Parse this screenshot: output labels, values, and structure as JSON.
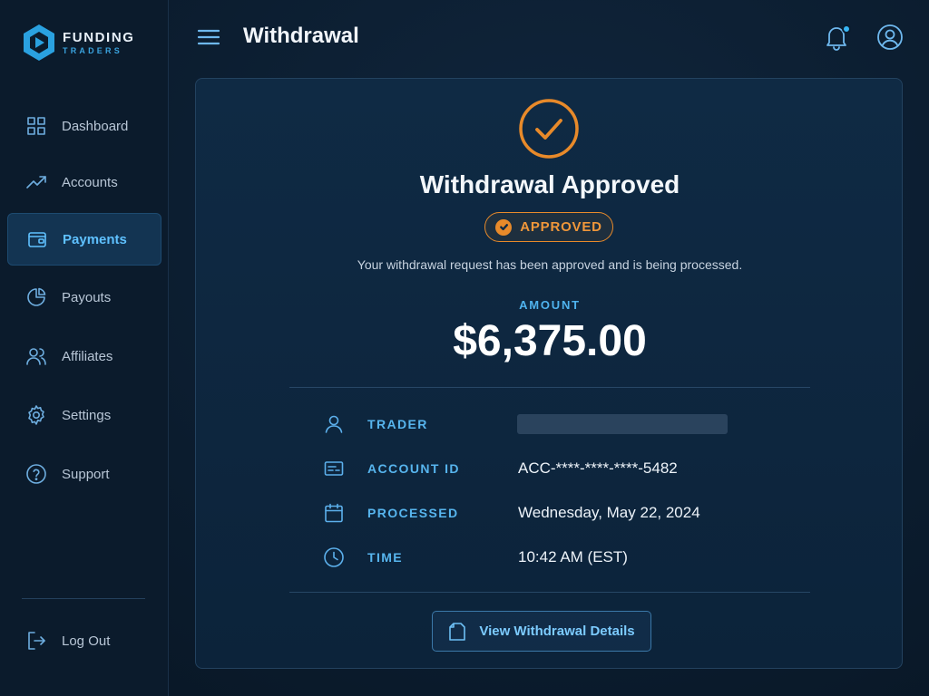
{
  "brand": {
    "title": "FUNDING",
    "subtitle": "TRADERS"
  },
  "sidebar": {
    "items": [
      {
        "label": "Dashboard",
        "icon": "grid-icon",
        "active": false
      },
      {
        "label": "Accounts",
        "icon": "trend-icon",
        "active": false
      },
      {
        "label": "Payments",
        "icon": "wallet-icon",
        "active": true
      },
      {
        "label": "Payouts",
        "icon": "pie-icon",
        "active": false
      },
      {
        "label": "Affiliates",
        "icon": "users-icon",
        "active": false
      },
      {
        "label": "Settings",
        "icon": "gear-icon",
        "active": false
      },
      {
        "label": "Support",
        "icon": "help-icon",
        "active": false
      }
    ],
    "logout_label": "Log Out"
  },
  "header": {
    "title": "Withdrawal"
  },
  "card": {
    "title": "Withdrawal Approved",
    "badge": "APPROVED",
    "message": "Your withdrawal request has been approved and is being processed.",
    "amount_label": "AMOUNT",
    "amount": "$6,375.00",
    "details": [
      {
        "label": "TRADER",
        "value": "",
        "redacted": true,
        "icon": "person-icon"
      },
      {
        "label": "ACCOUNT ID",
        "value": "ACC-****-****-****-5482",
        "icon": "id-card-icon"
      },
      {
        "label": "PROCESSED",
        "value": "Wednesday, May 22, 2024",
        "icon": "calendar-icon"
      },
      {
        "label": "TIME",
        "value": "10:42 AM (EST)",
        "icon": "clock-icon"
      }
    ],
    "button_label": "View Withdrawal Details"
  },
  "colors": {
    "accent": "#4fb3ee",
    "status": "#e88a2a",
    "background": "#0b1c2e"
  }
}
